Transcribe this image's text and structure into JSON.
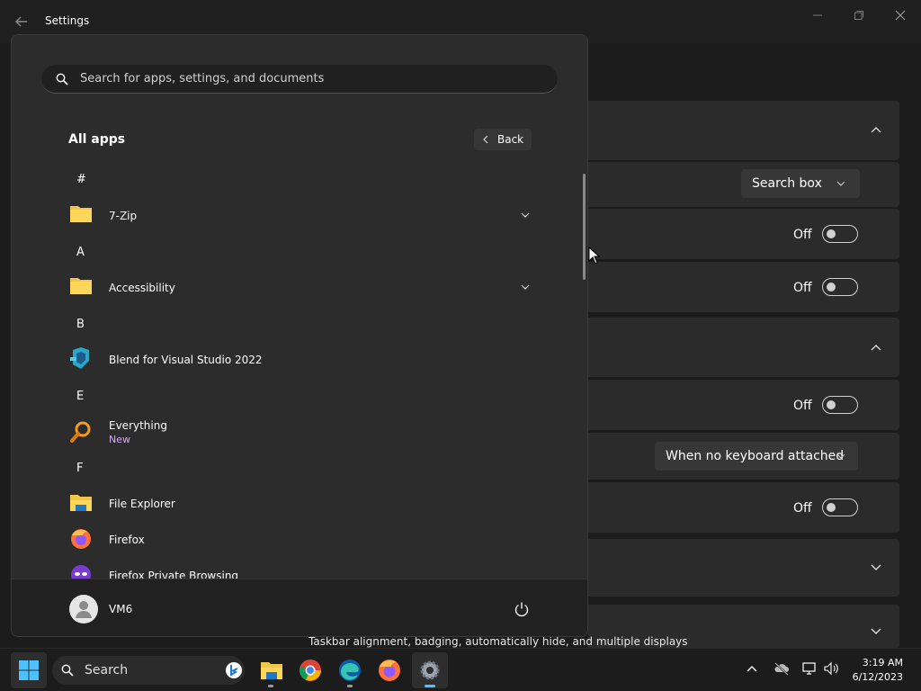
{
  "window": {
    "title": "Settings",
    "minimize_icon": "minimize-icon",
    "restore_icon": "restore-icon",
    "close_icon": "close-icon"
  },
  "settings_panel": {
    "search_box_value": "Search box",
    "toggle_off_label": "Off",
    "keyboard_dropdown_value": "When no keyboard attached",
    "hint": "Taskbar alignment, badging, automatically hide, and multiple displays"
  },
  "start_menu": {
    "search_placeholder": "Search for apps, settings, and documents",
    "all_apps_title": "All apps",
    "back_label": "Back",
    "letters": [
      "#",
      "A",
      "B",
      "E",
      "F"
    ],
    "apps": [
      {
        "name": "7-Zip",
        "icon": "folder-icon"
      },
      {
        "name": "Accessibility",
        "icon": "folder-icon"
      },
      {
        "name": "Blend for Visual Studio 2022",
        "icon": "blend-icon"
      },
      {
        "name": "Everything",
        "sub": "New",
        "icon": "magnifier-icon"
      },
      {
        "name": "File Explorer",
        "icon": "file-explorer-icon"
      },
      {
        "name": "Firefox",
        "icon": "firefox-icon"
      },
      {
        "name": "Firefox Private Browsing",
        "icon": "firefox-private-icon"
      }
    ],
    "user_name": "VM6"
  },
  "taskbar": {
    "search_label": "Search",
    "time": "3:19 AM",
    "date": "6/12/2023"
  },
  "colors": {
    "accent_blue": "#0078d4",
    "panel_bg": "#2c2c2c",
    "sub_label_purple": "#d7a6ff"
  }
}
